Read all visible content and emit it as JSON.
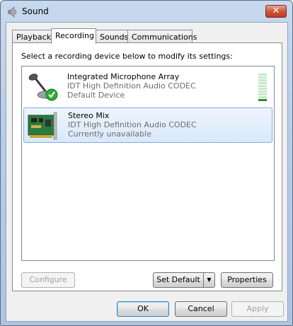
{
  "window": {
    "title": "Sound",
    "close_label": "✕"
  },
  "tabs": [
    {
      "label": "Playback",
      "active": false
    },
    {
      "label": "Recording",
      "active": true
    },
    {
      "label": "Sounds",
      "active": false
    },
    {
      "label": "Communications",
      "active": false
    }
  ],
  "panel": {
    "instructions": "Select a recording device below to modify its settings:"
  },
  "devices": [
    {
      "name": "Integrated Microphone Array",
      "driver": "IDT High Definition Audio CODEC",
      "status": "Default Device",
      "icon": "microphone-icon",
      "default": true,
      "selected": false
    },
    {
      "name": "Stereo Mix",
      "driver": "IDT High Definition Audio CODEC",
      "status": "Currently unavailable",
      "icon": "sound-card-icon",
      "default": false,
      "selected": true
    }
  ],
  "buttons": {
    "configure": "Configure",
    "set_default": "Set Default",
    "properties": "Properties",
    "ok": "OK",
    "cancel": "Cancel",
    "apply": "Apply"
  },
  "level_meter": {
    "level": 0.1
  },
  "colors": {
    "selection": "#d9e8fb",
    "selection_border": "#84acdd",
    "meter_on": "#2e8b2e"
  }
}
